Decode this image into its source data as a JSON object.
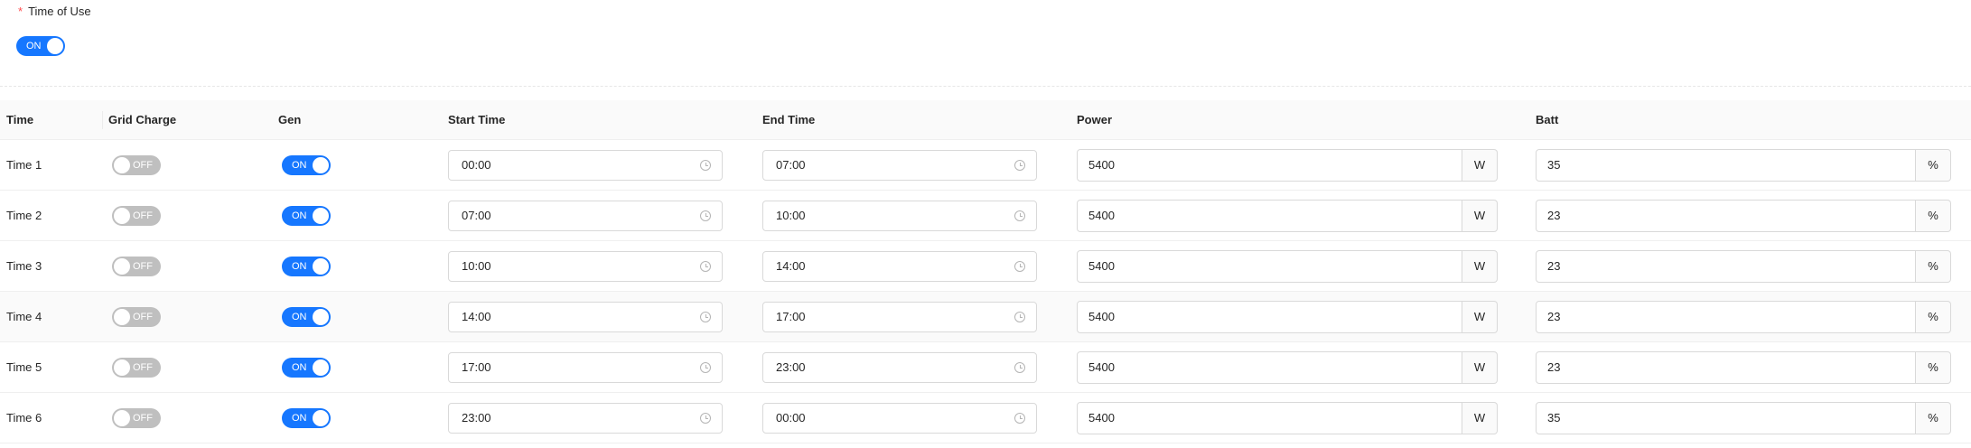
{
  "time_of_use": {
    "required_mark": "*",
    "label": "Time of Use",
    "toggle_text": "ON",
    "enabled": true
  },
  "table": {
    "headers": [
      "Time",
      "Grid Charge",
      "Gen",
      "Start Time",
      "End Time",
      "Power",
      "Batt"
    ],
    "rows": [
      {
        "time": "Time 1",
        "grid_charge": "OFF",
        "gen": "ON",
        "start": "00:00",
        "end": "07:00",
        "power": "5400",
        "power_unit": "W",
        "batt": "35",
        "batt_unit": "%"
      },
      {
        "time": "Time 2",
        "grid_charge": "OFF",
        "gen": "ON",
        "start": "07:00",
        "end": "10:00",
        "power": "5400",
        "power_unit": "W",
        "batt": "23",
        "batt_unit": "%"
      },
      {
        "time": "Time 3",
        "grid_charge": "OFF",
        "gen": "ON",
        "start": "10:00",
        "end": "14:00",
        "power": "5400",
        "power_unit": "W",
        "batt": "23",
        "batt_unit": "%"
      },
      {
        "time": "Time 4",
        "grid_charge": "OFF",
        "gen": "ON",
        "start": "14:00",
        "end": "17:00",
        "power": "5400",
        "power_unit": "W",
        "batt": "23",
        "batt_unit": "%"
      },
      {
        "time": "Time 5",
        "grid_charge": "OFF",
        "gen": "ON",
        "start": "17:00",
        "end": "23:00",
        "power": "5400",
        "power_unit": "W",
        "batt": "23",
        "batt_unit": "%"
      },
      {
        "time": "Time 6",
        "grid_charge": "OFF",
        "gen": "ON",
        "start": "23:00",
        "end": "00:00",
        "power": "5400",
        "power_unit": "W",
        "batt": "35",
        "batt_unit": "%"
      }
    ]
  },
  "colors": {
    "toggle_on": "#1677ff",
    "toggle_off": "#bfbfbf",
    "required": "#ff4d4f"
  },
  "icons": {
    "time_input": "clock-icon"
  }
}
